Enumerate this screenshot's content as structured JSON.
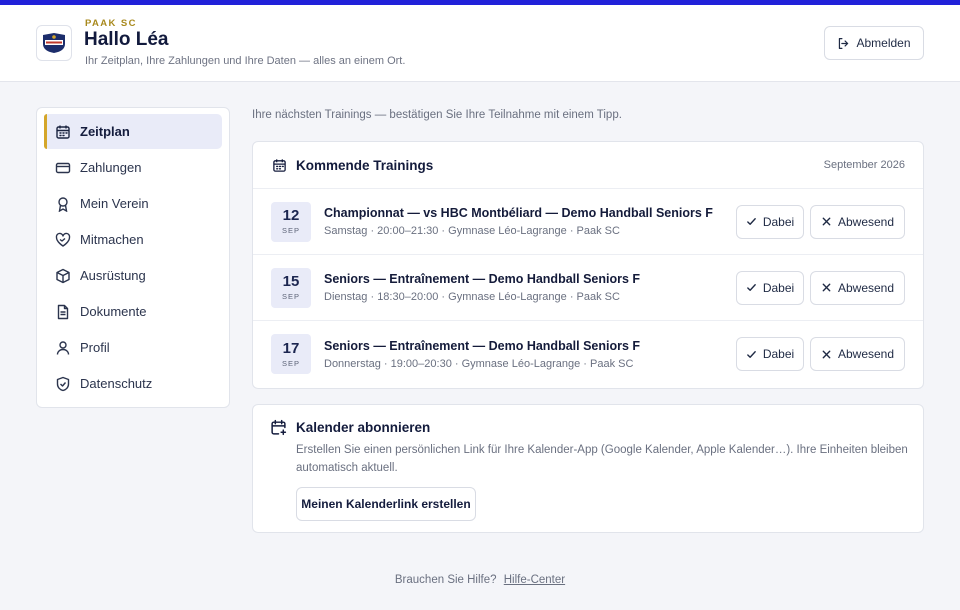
{
  "header": {
    "club_name": "PAAK SC",
    "greeting": "Hallo Léa",
    "subtitle": "Ihr Zeitplan, Ihre Zahlungen und Ihre Daten — alles an einem Ort.",
    "logout_label": "Abmelden",
    "logo_icon": "club-crest-logo"
  },
  "sidebar": {
    "items": [
      {
        "label": "Zeitplan",
        "icon": "calendar-icon",
        "active": true
      },
      {
        "label": "Zahlungen",
        "icon": "credit-card-icon"
      },
      {
        "label": "Mein Verein",
        "icon": "award-icon"
      },
      {
        "label": "Mitmachen",
        "icon": "heart-handshake-icon"
      },
      {
        "label": "Ausrüstung",
        "icon": "package-icon"
      },
      {
        "label": "Dokumente",
        "icon": "file-icon"
      },
      {
        "label": "Profil",
        "icon": "user-icon"
      },
      {
        "label": "Datenschutz",
        "icon": "shield-icon"
      }
    ]
  },
  "main": {
    "intro": "Ihre nächsten Trainings — bestätigen Sie Ihre Teilnahme mit einem Tipp.",
    "trainings": {
      "title": "Kommende Trainings",
      "month": "September 2026",
      "yes_label": "Dabei",
      "no_label": "Abwesend",
      "events": [
        {
          "day": "12",
          "month": "SEP",
          "title": "Championnat — vs HBC Montbéliard — Demo Handball Seniors F",
          "meta": "Samstag · 20:00–21:30 · Gymnase Léo-Lagrange · Paak SC"
        },
        {
          "day": "15",
          "month": "SEP",
          "title": "Seniors — Entraînement — Demo Handball Seniors F",
          "meta": "Dienstag · 18:30–20:00 · Gymnase Léo-Lagrange · Paak SC"
        },
        {
          "day": "17",
          "month": "SEP",
          "title": "Seniors — Entraînement — Demo Handball Seniors F",
          "meta": "Donnerstag · 19:00–20:30 · Gymnase Léo-Lagrange · Paak SC"
        }
      ]
    },
    "subscribe": {
      "title": "Kalender abonnieren",
      "text": "Erstellen Sie einen persönlichen Link für Ihre Kalender-App (Google Kalender, Apple Kalender…). Ihre Einheiten bleiben automatisch aktuell.",
      "button_label": "Meinen Kalenderlink erstellen"
    }
  },
  "footer": {
    "help_text": "Brauchen Sie Hilfe?",
    "help_link": "Hilfe-Center"
  },
  "colors": {
    "accent_bar": "#2121d9",
    "gold": "#d4a62a",
    "active_bg": "#e9ebf8"
  }
}
